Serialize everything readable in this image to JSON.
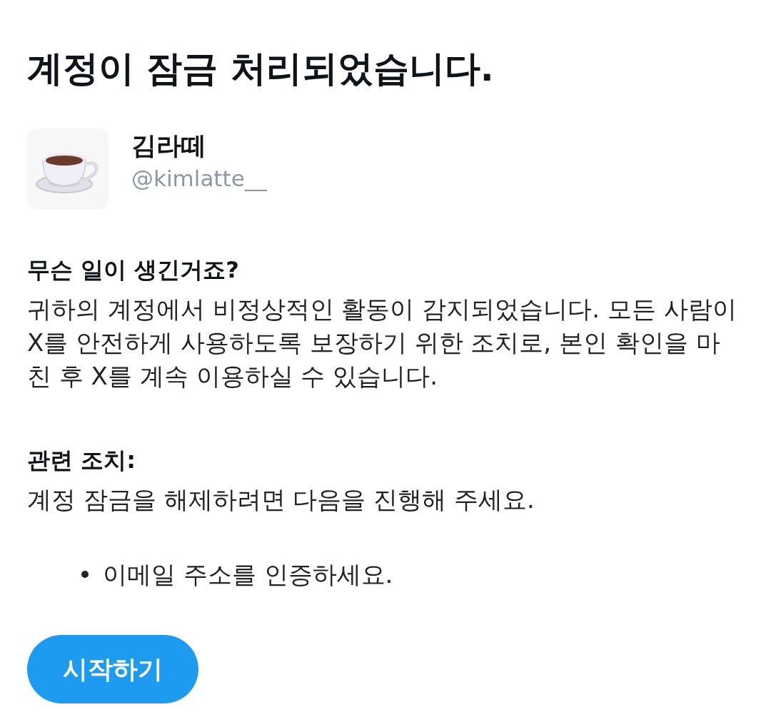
{
  "page": {
    "title": "계정이 잠금 처리되었습니다."
  },
  "account": {
    "name": "김라떼",
    "handle": "@kimlatte__"
  },
  "sections": [
    {
      "heading": "무슨 일이 생긴거죠?",
      "body": "귀하의 계정에서 비정상적인 활동이 감지되었습니다. 모든 사람이 X를 안전하게 사용하도록 보장하기 위한 조치로, 본인 확인을 마친 후 X를 계속 이용하실 수 있습니다."
    },
    {
      "heading": "관련 조치:",
      "body": "계정 잠금을 해제하려면 다음을 진행해 주세요.",
      "steps": [
        "이메일 주소를 인증하세요."
      ]
    }
  ],
  "button": {
    "label": "시작하기"
  }
}
